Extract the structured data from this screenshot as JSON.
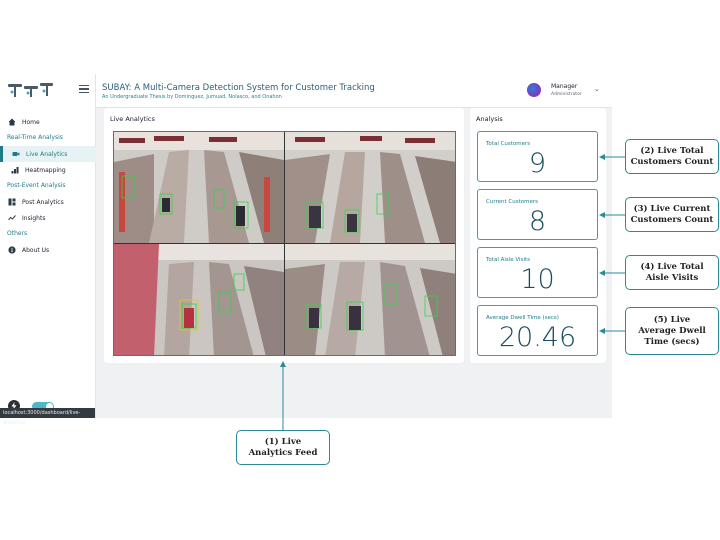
{
  "app": {
    "title": "SUBAY: A Multi-Camera Detection System for Customer Tracking",
    "subtitle": "An Undergraduate Thesis by Dominguez, Jumuad, Nolasco, and Onahon"
  },
  "user": {
    "name": "Manager",
    "role": "Administrator"
  },
  "sidebar": {
    "sections": [
      {
        "items": [
          {
            "label": "Home",
            "icon": "home-icon"
          }
        ]
      },
      {
        "heading": "Real-Time Analysis",
        "items": [
          {
            "label": "Live Analytics",
            "icon": "camera-icon",
            "active": true
          },
          {
            "label": "Heatmapping",
            "icon": "heatmap-icon"
          }
        ]
      },
      {
        "heading": "Post-Event Analysis",
        "items": [
          {
            "label": "Post Analytics",
            "icon": "dashboard-icon"
          },
          {
            "label": "Insights",
            "icon": "trend-icon"
          }
        ]
      },
      {
        "heading": "Others",
        "items": [
          {
            "label": "About Us",
            "icon": "info-icon"
          }
        ]
      }
    ]
  },
  "status_url": "localhost:3000/dashboard/live-analytics",
  "live_panel": {
    "title": "Live Analytics"
  },
  "analysis_panel": {
    "title": "Analysis",
    "stats": [
      {
        "label": "Total Customers",
        "value": "9"
      },
      {
        "label": "Current Customers",
        "value": "8"
      },
      {
        "label": "Total Aisle Visits",
        "value": "10"
      },
      {
        "label": "Average Dwell Time (secs)",
        "value": "20.46"
      }
    ]
  },
  "annotations": {
    "feed": [
      "(1) Live",
      "Analytics Feed"
    ],
    "total": [
      "(2) Live Total",
      "Customers Count"
    ],
    "current": [
      "(3) Live Current",
      "Customers Count"
    ],
    "aisle": [
      "(4) Live Total",
      "Aisle Visits"
    ],
    "dwell": [
      "(5) Live",
      "Average Dwell",
      "Time (secs)"
    ]
  },
  "colors": {
    "accent": "#1c7c88",
    "value": "#1b4d60",
    "annotation_border": "#2a8a98"
  }
}
